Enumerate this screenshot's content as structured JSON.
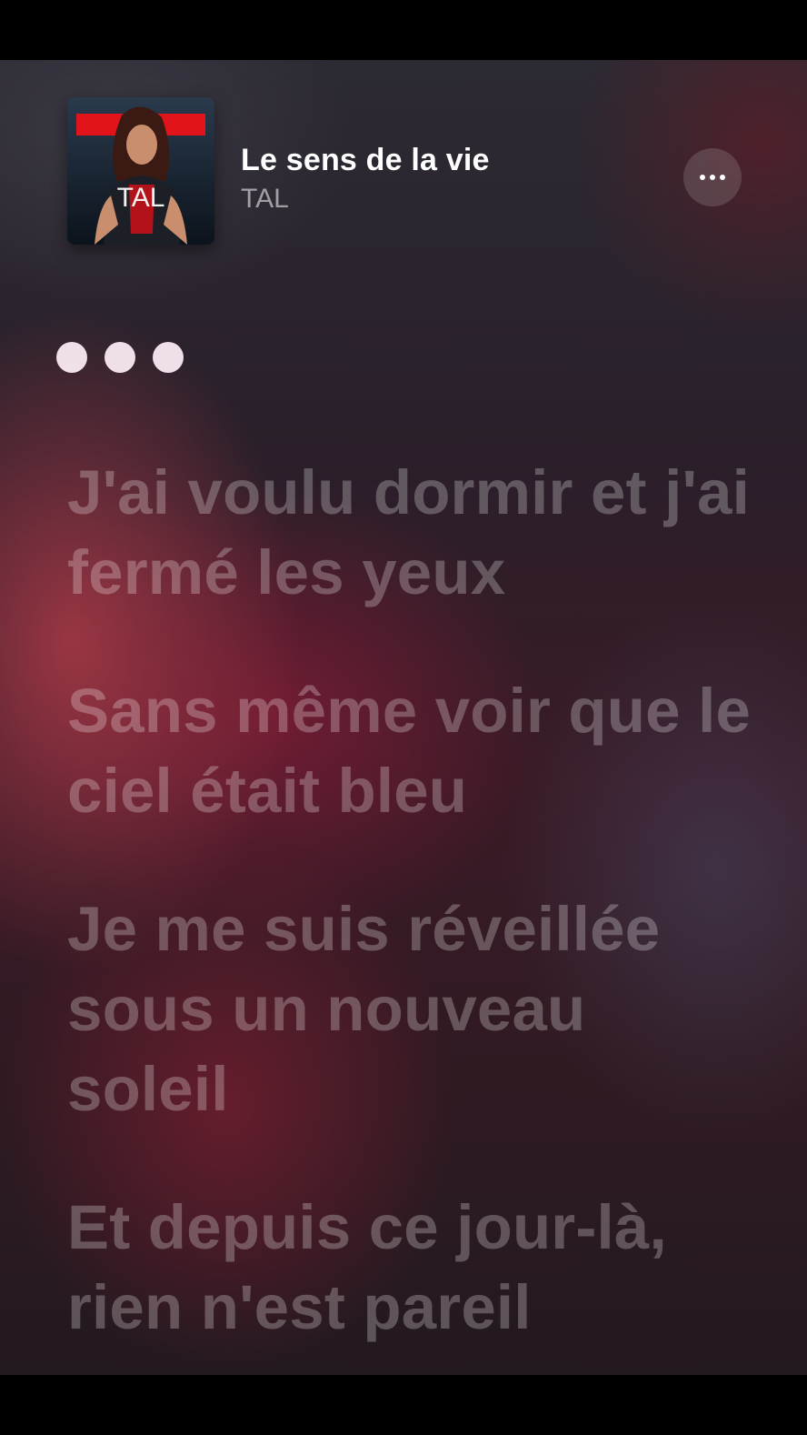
{
  "now_playing": {
    "title": "Le sens de la vie",
    "artist": "TAL",
    "album_art_text": "TAL"
  },
  "menu": {
    "icon": "more-horizontal-icon"
  },
  "interlude_indicator": {
    "icon": "three-dots-interlude-icon"
  },
  "lyrics": [
    "J'ai voulu dormir et j'ai fermé les yeux",
    "Sans même voir que le ciel était bleu",
    "Je me suis réveillée sous un nouveau soleil",
    "Et depuis ce jour-là, rien n'est pareil"
  ]
}
